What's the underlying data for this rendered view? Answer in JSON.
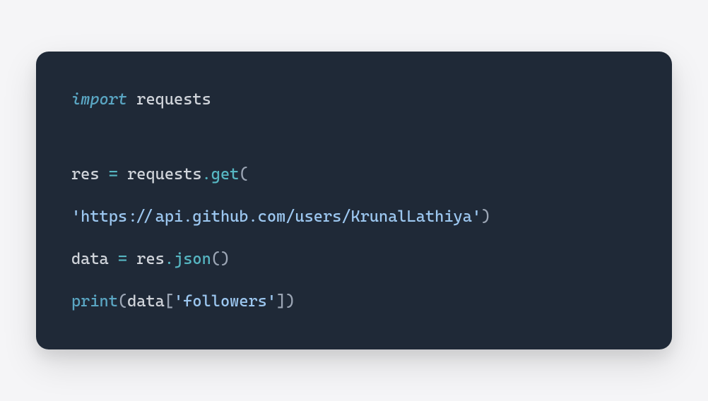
{
  "code": {
    "line1": {
      "keyword": "import",
      "module": " requests"
    },
    "line2": {
      "lhs": "res ",
      "eq": "=",
      "obj": " requests",
      "dot": ".",
      "method": "get",
      "open": "("
    },
    "line3": {
      "str": "'https://api.github.com/users/KrunalLathiya'",
      "close": ")"
    },
    "line4": {
      "lhs": "data ",
      "eq": "=",
      "obj": " res",
      "dot": ".",
      "method": "json",
      "parens": "()"
    },
    "line5": {
      "func": "print",
      "open": "(",
      "arg": "data",
      "bopen": "[",
      "str": "'followers'",
      "bclose": "]",
      "close": ")"
    }
  }
}
